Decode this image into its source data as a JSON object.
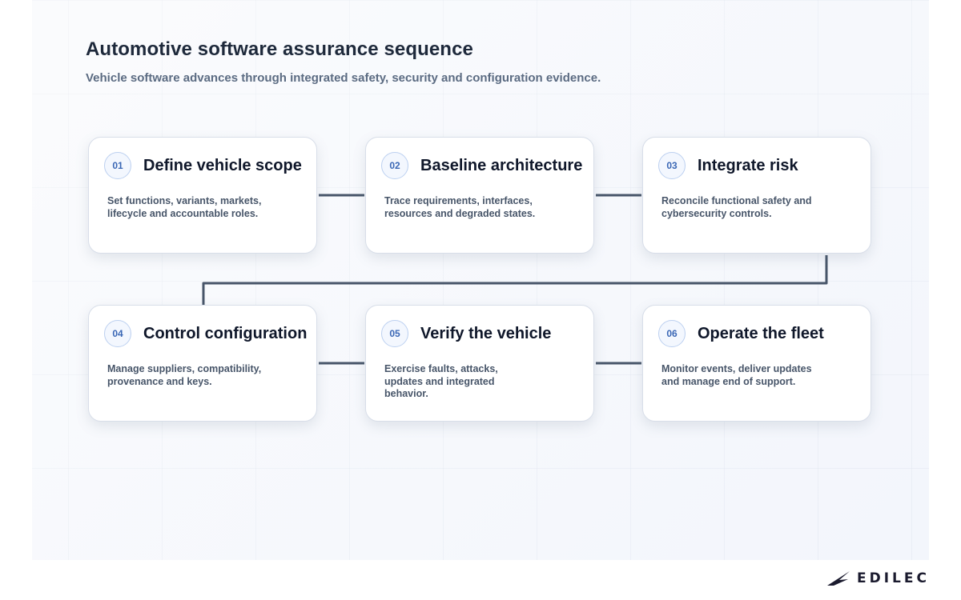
{
  "header": {
    "title": "Automotive software assurance sequence",
    "subtitle": "Vehicle software advances through integrated safety, security and configuration evidence."
  },
  "steps": [
    {
      "number": "01",
      "title": "Define vehicle scope",
      "description": "Set functions, variants, markets, lifecycle and accountable roles."
    },
    {
      "number": "02",
      "title": "Baseline architecture",
      "description": "Trace requirements, interfaces, resources and degraded states."
    },
    {
      "number": "03",
      "title": "Integrate risk",
      "description": "Reconcile functional safety and cybersecurity controls."
    },
    {
      "number": "04",
      "title": "Control configuration",
      "description": "Manage suppliers, compatibility, provenance and keys."
    },
    {
      "number": "05",
      "title": "Verify the vehicle",
      "description": "Exercise faults, attacks, updates and integrated behavior."
    },
    {
      "number": "06",
      "title": "Operate the fleet",
      "description": "Monitor events, deliver updates and manage end of support."
    }
  ],
  "logo": {
    "text": "EDILEC",
    "icon": "bird-icon"
  },
  "colors": {
    "connector": "#475569",
    "badge_text": "#3a67b5",
    "badge_border": "#bcd0f0"
  }
}
